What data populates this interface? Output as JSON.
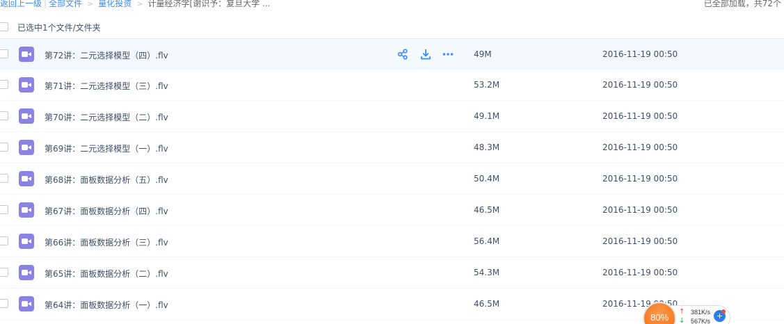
{
  "breadcrumb": {
    "back": "返回上一级",
    "all_files": "全部文件",
    "folder": "量化投资",
    "current": "计量经济学[谢识予：复旦大学 ..."
  },
  "status": {
    "loaded_text": "已全部加载，共72个"
  },
  "selection": {
    "text": "已选中1个文件/文件夹"
  },
  "files": [
    {
      "name": "第72讲：二元选择模型（四）.flv",
      "size": "49M",
      "date": "2016-11-19 00:50"
    },
    {
      "name": "第71讲：二元选择模型（三）.flv",
      "size": "53.2M",
      "date": "2016-11-19 00:50"
    },
    {
      "name": "第70讲：二元选择模型（二）.flv",
      "size": "49.1M",
      "date": "2016-11-19 00:50"
    },
    {
      "name": "第69讲：二元选择模型（一）.flv",
      "size": "48.3M",
      "date": "2016-11-19 00:50"
    },
    {
      "name": "第68讲：面板数据分析（五）.flv",
      "size": "50.4M",
      "date": "2016-11-19 00:50"
    },
    {
      "name": "第67讲：面板数据分析（四）.flv",
      "size": "46.5M",
      "date": "2016-11-19 00:50"
    },
    {
      "name": "第66讲：面板数据分析（三）.flv",
      "size": "56.4M",
      "date": "2016-11-19 00:50"
    },
    {
      "name": "第65讲：面板数据分析（二）.flv",
      "size": "54.3M",
      "date": "2016-11-19 00:50"
    },
    {
      "name": "第64讲：面板数据分析（一）.flv",
      "size": "46.5M",
      "date": "2016-11-19 00:50"
    }
  ],
  "row_actions": {
    "share_icon": "share-icon",
    "download_icon": "download-icon",
    "more_icon": "more-icon"
  },
  "speed_widget": {
    "percent": "80%",
    "upload": "381K/s",
    "download": "567K/s",
    "up_arrow": "↑",
    "down_arrow": "↓",
    "plus": "+"
  },
  "colors": {
    "link": "#3b8cff",
    "video_icon": "#8c82e6",
    "hover_row": "#f4f8ff",
    "widget_orange": "#f06a12"
  }
}
